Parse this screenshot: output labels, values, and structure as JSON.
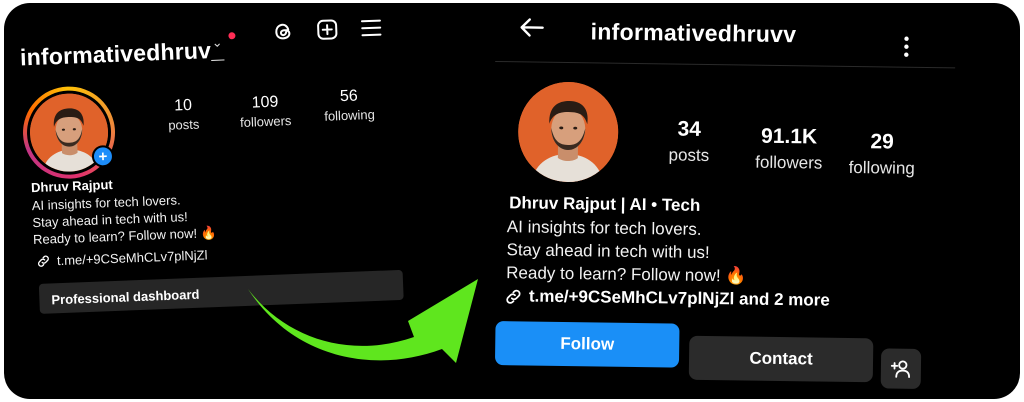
{
  "left_profile": {
    "username": "informativedhruv_",
    "username_menu_icon": "chevron-down-icon",
    "notification_color": "#ff2d55",
    "top_icons": [
      "threads-icon",
      "plus-square-icon",
      "menu-icon"
    ],
    "stats": [
      {
        "value": "10",
        "label": "posts"
      },
      {
        "value": "109",
        "label": "followers"
      },
      {
        "value": "56",
        "label": "following"
      }
    ],
    "name": "Dhruv Rajput",
    "bio_lines": [
      "AI insights for tech lovers.",
      "Stay ahead in tech with us!",
      "Ready to learn? Follow now! 🔥"
    ],
    "link": "t.me/+9CSeMhCLv7plNjZl",
    "dashboard_label": "Professional dashboard",
    "add_story_symbol": "+"
  },
  "right_profile": {
    "username": "informativedhruvv",
    "stats": [
      {
        "value": "34",
        "label": "posts"
      },
      {
        "value": "91.1K",
        "label": "followers"
      },
      {
        "value": "29",
        "label": "following"
      }
    ],
    "name": "Dhruv Rajput | AI • Tech",
    "bio_lines": [
      "AI insights for tech lovers.",
      "Stay ahead in tech with us!",
      "Ready to learn? Follow now! 🔥"
    ],
    "link": "t.me/+9CSeMhCLv7plNjZl and 2 more",
    "follow_label": "Follow",
    "contact_label": "Contact",
    "add_user_icon": "add-user-icon"
  },
  "colors": {
    "background": "#000000",
    "follow_button": "#1a8ff7",
    "secondary_button": "#2b2b2b",
    "arrow": "#5fe61e",
    "avatar_bg": "#e0622a"
  }
}
